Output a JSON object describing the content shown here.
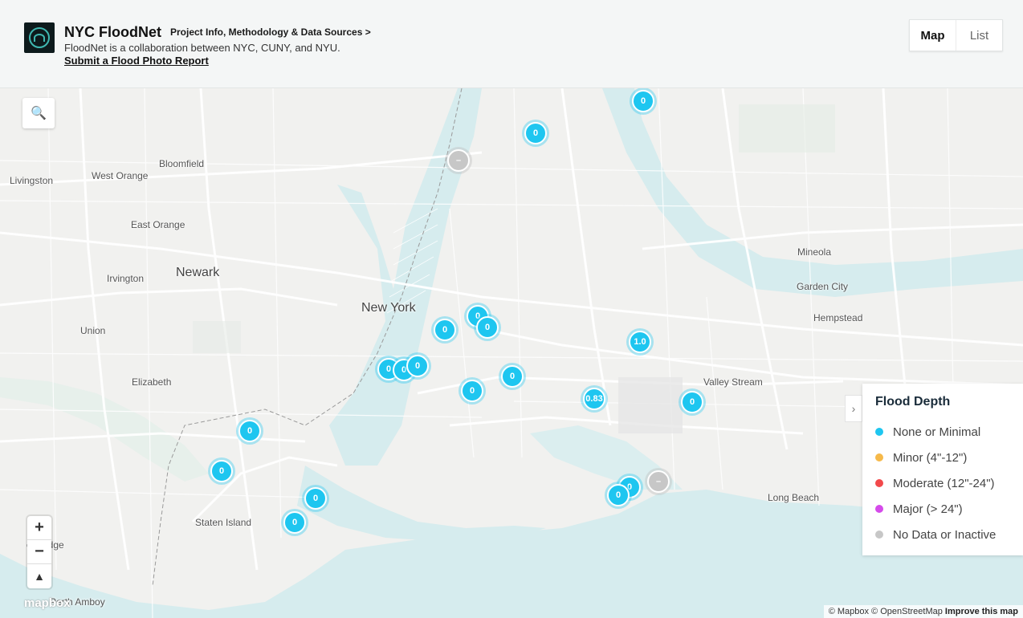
{
  "header": {
    "title": "NYC FloodNet",
    "project_link": "Project Info, Methodology & Data Sources >",
    "subtitle": "FloodNet is a collaboration between NYC, CUNY, and NYU.",
    "report_link": "Submit a Flood Photo Report",
    "view_toggle": {
      "map": "Map",
      "list": "List",
      "active": "Map"
    }
  },
  "map": {
    "places": [
      {
        "label": "Livingston"
      },
      {
        "label": "West Orange"
      },
      {
        "label": "Bloomfield"
      },
      {
        "label": "East Orange"
      },
      {
        "label": "Newark"
      },
      {
        "label": "Irvington"
      },
      {
        "label": "Union"
      },
      {
        "label": "Elizabeth"
      },
      {
        "label": "New York"
      },
      {
        "label": "Mineola"
      },
      {
        "label": "Garden City"
      },
      {
        "label": "Hempstead"
      },
      {
        "label": "Valley Stream"
      },
      {
        "label": "Long Beach"
      },
      {
        "label": "Staten Island"
      },
      {
        "label": "odbridge"
      },
      {
        "label": "Perth Amboy"
      }
    ],
    "markers": [
      {
        "label": "0",
        "status": "none"
      },
      {
        "label": "0",
        "status": "none"
      },
      {
        "label": "–",
        "status": "inactive"
      },
      {
        "label": "0",
        "status": "none"
      },
      {
        "label": "0",
        "status": "none"
      },
      {
        "label": "0",
        "status": "none"
      },
      {
        "label": "0",
        "status": "none"
      },
      {
        "label": "0",
        "status": "none"
      },
      {
        "label": "0",
        "status": "none"
      },
      {
        "label": "0",
        "status": "none"
      },
      {
        "label": "1.0",
        "status": "none"
      },
      {
        "label": "0",
        "status": "none"
      },
      {
        "label": "0",
        "status": "none"
      },
      {
        "label": "0.83",
        "status": "none"
      },
      {
        "label": "0",
        "status": "none"
      },
      {
        "label": "0",
        "status": "none"
      },
      {
        "label": "0",
        "status": "none"
      },
      {
        "label": "0",
        "status": "none"
      },
      {
        "label": "0",
        "status": "none"
      },
      {
        "label": "–",
        "status": "inactive"
      },
      {
        "label": "0",
        "status": "none"
      }
    ],
    "mapbox_logo": "mapbox",
    "attribution": "© Mapbox © OpenStreetMap",
    "improve_link": "Improve this map"
  },
  "legend": {
    "title": "Flood Depth",
    "items": [
      {
        "label": "None or Minimal",
        "color": "#1ec6f0"
      },
      {
        "label": "Minor (4\"-12\")",
        "color": "#f6b94a"
      },
      {
        "label": "Moderate (12\"-24\")",
        "color": "#f2494b"
      },
      {
        "label": "Major (> 24\")",
        "color": "#d54bea"
      },
      {
        "label": "No Data or Inactive",
        "color": "#c7c7c7"
      }
    ]
  }
}
